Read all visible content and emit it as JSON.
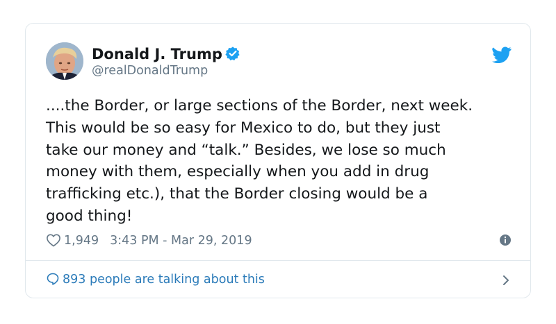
{
  "user": {
    "display_name": "Donald J. Trump",
    "handle": "@realDonaldTrump",
    "verified": true,
    "avatar_icon": "profile-photo"
  },
  "tweet": {
    "text": "....the Border, or large sections of the Border, next week.\nThis would be so easy for Mexico to do, but they just\ntake our money and “talk.” Besides, we lose so much\nmoney with them, especially when you add in drug\ntrafficking etc.), that the Border closing would be a\ngood thing!"
  },
  "meta": {
    "likes": "1,949",
    "timestamp": "3:43 PM - Mar 29, 2019"
  },
  "footer": {
    "label": "893 people are talking about this"
  },
  "colors": {
    "text": "#14171a",
    "secondary": "#657786",
    "accent": "#1da1f2",
    "link": "#2b7bb9",
    "border": "#e1e8ed"
  },
  "icons": [
    "verified-badge-icon",
    "twitter-bird-icon",
    "heart-icon",
    "info-icon",
    "reply-bubble-icon",
    "chevron-right-icon"
  ]
}
